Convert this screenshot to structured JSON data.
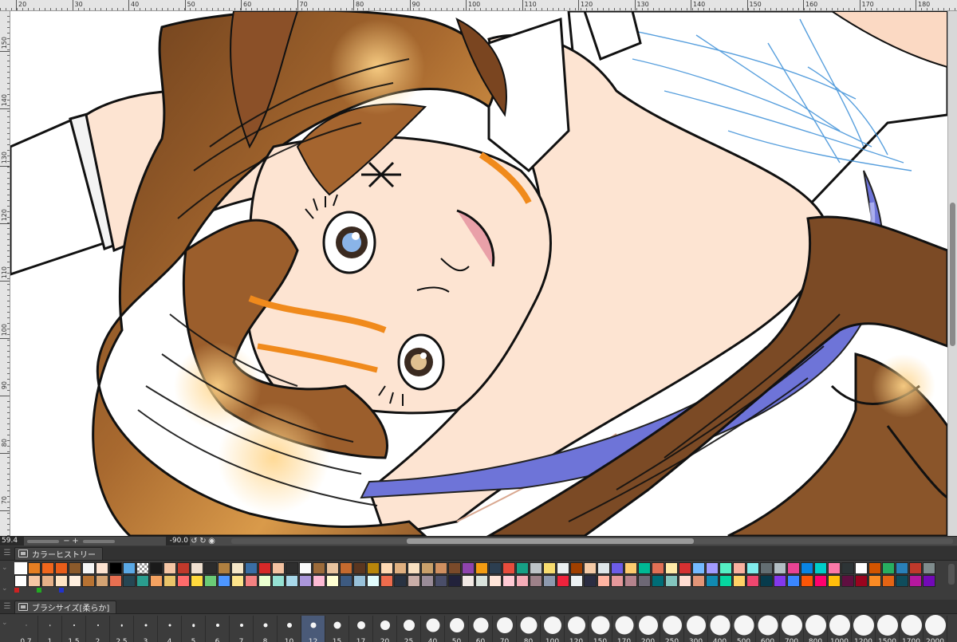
{
  "rulers": {
    "top_labels": [
      "20",
      "30",
      "40",
      "50",
      "60",
      "70",
      "80",
      "90",
      "100",
      "110",
      "120",
      "130",
      "140",
      "150",
      "160",
      "170",
      "180"
    ],
    "left_labels": [
      "150",
      "140",
      "130",
      "120",
      "110",
      "100",
      "90",
      "80",
      "70"
    ]
  },
  "navigator": {
    "zoom": "59.4",
    "zoom_out_icon": "minus-icon",
    "zoom_in_icon": "plus-icon",
    "angle": "-90.0",
    "rotate_left_icon": "rotate-left-icon",
    "rotate_right_icon": "rotate-right-icon",
    "reset_icon": "reset-icon"
  },
  "color_history": {
    "tab_label": "カラーヒストリー",
    "colors": [
      "#ffffff",
      "#e67e22",
      "#f0661c",
      "#e85d1a",
      "#8b5a2b",
      "#f5f5f5",
      "#fde3d1",
      "#000000",
      "#5aa9e6",
      "checker",
      "#1a1a1a",
      "#f5c6a5",
      "#c0392b",
      "#f0e0d0",
      "#2c2c2c",
      "#b08040",
      "#f5e6c8",
      "#3a6ea5",
      "#d62828",
      "#f4c2a1",
      "#2e2e2e",
      "#fafafa",
      "#9c6b3a",
      "#e8c39e",
      "#c56a2e",
      "#5a3620",
      "#b8860b",
      "#ffd9b3",
      "#e0b080",
      "#f9e0c0",
      "#c9a06a",
      "#d09060",
      "#7a4a2a",
      "#8e44ad",
      "#f39c12",
      "#2c3e50",
      "#e74c3c",
      "#16a085",
      "#bdc3c7",
      "#f7dc6f",
      "#ecf0f1",
      "#a04000",
      "#f5cba7",
      "#dfe6e9",
      "#6c5ce7",
      "#fdcb6e",
      "#00b894",
      "#e17055",
      "#ffeaa7",
      "#d63031",
      "#74b9ff",
      "#a29bfe",
      "#55efc4",
      "#fab1a0",
      "#81ecec",
      "#636e72",
      "#b2bec3",
      "#e84393",
      "#0984e3",
      "#00cec9",
      "#fd79a8",
      "#2d3436",
      "#ffffff",
      "#d35400",
      "#27ae60",
      "#2980b9",
      "#c0392b",
      "#7f8c8d",
      "#ffffff",
      "#f5c6a5",
      "#e6b088",
      "#ffe4c4",
      "#fff0e0",
      "#b87333",
      "#d4a373",
      "#e76f51",
      "#264653",
      "#2a9d8f",
      "#f4a261",
      "#e9c46a",
      "#ff6b6b",
      "#ffd93d",
      "#6bcb77",
      "#4d96ff",
      "#fce38a",
      "#f38181",
      "#eaffd0",
      "#95e1d3",
      "#a8d8ea",
      "#aa96da",
      "#fcbad3",
      "#ffffd2",
      "#3d5a80",
      "#98c1d9",
      "#e0fbfc",
      "#ee6c4d",
      "#293241",
      "#c9ada7",
      "#9a8c98",
      "#4a4e69",
      "#22223b",
      "#f2e9e4",
      "#d8e2dc",
      "#ffe5d9",
      "#ffcad4",
      "#f4acb7",
      "#9d8189",
      "#8d99ae",
      "#ef233c",
      "#edf2f4",
      "#2b2d42",
      "#ffb4a2",
      "#e5989b",
      "#b5838d",
      "#6d6875",
      "#006d77",
      "#83c5be",
      "#ffddd2",
      "#e29578",
      "#118ab2",
      "#06d6a0",
      "#ffd166",
      "#ef476f",
      "#073b4c",
      "#8338ec",
      "#3a86ff",
      "#fb5607",
      "#ff006e",
      "#ffbe0b",
      "#5f0f40",
      "#9a031e",
      "#fb8b24",
      "#e36414",
      "#0f4c5c",
      "#b5179e",
      "#7209b7"
    ],
    "mini_colors": [
      "#cc2222",
      "#22aa22",
      "#2233cc"
    ]
  },
  "brush_size": {
    "tab_label": "ブラシサイズ[柔らか]",
    "sizes": [
      {
        "label": "0.7",
        "d": 1
      },
      {
        "label": "1",
        "d": 1.5
      },
      {
        "label": "1.5",
        "d": 2
      },
      {
        "label": "2",
        "d": 2
      },
      {
        "label": "2.5",
        "d": 2.5
      },
      {
        "label": "3",
        "d": 3
      },
      {
        "label": "4",
        "d": 3
      },
      {
        "label": "5",
        "d": 3.5
      },
      {
        "label": "6",
        "d": 4
      },
      {
        "label": "7",
        "d": 4
      },
      {
        "label": "8",
        "d": 5
      },
      {
        "label": "10",
        "d": 6
      },
      {
        "label": "12",
        "d": 7,
        "selected": true
      },
      {
        "label": "15",
        "d": 9
      },
      {
        "label": "17",
        "d": 10
      },
      {
        "label": "20",
        "d": 12
      },
      {
        "label": "25",
        "d": 14
      },
      {
        "label": "40",
        "d": 17
      },
      {
        "label": "50",
        "d": 18
      },
      {
        "label": "60",
        "d": 19
      },
      {
        "label": "70",
        "d": 20
      },
      {
        "label": "80",
        "d": 21
      },
      {
        "label": "100",
        "d": 22
      },
      {
        "label": "120",
        "d": 22
      },
      {
        "label": "150",
        "d": 23
      },
      {
        "label": "170",
        "d": 23
      },
      {
        "label": "200",
        "d": 24
      },
      {
        "label": "250",
        "d": 24
      },
      {
        "label": "300",
        "d": 24
      },
      {
        "label": "400",
        "d": 25
      },
      {
        "label": "500",
        "d": 25
      },
      {
        "label": "600",
        "d": 25
      },
      {
        "label": "700",
        "d": 26
      },
      {
        "label": "800",
        "d": 26
      },
      {
        "label": "1000",
        "d": 26
      },
      {
        "label": "1200",
        "d": 26
      },
      {
        "label": "1500",
        "d": 26
      },
      {
        "label": "1700",
        "d": 26
      },
      {
        "label": "2000",
        "d": 26
      }
    ]
  }
}
